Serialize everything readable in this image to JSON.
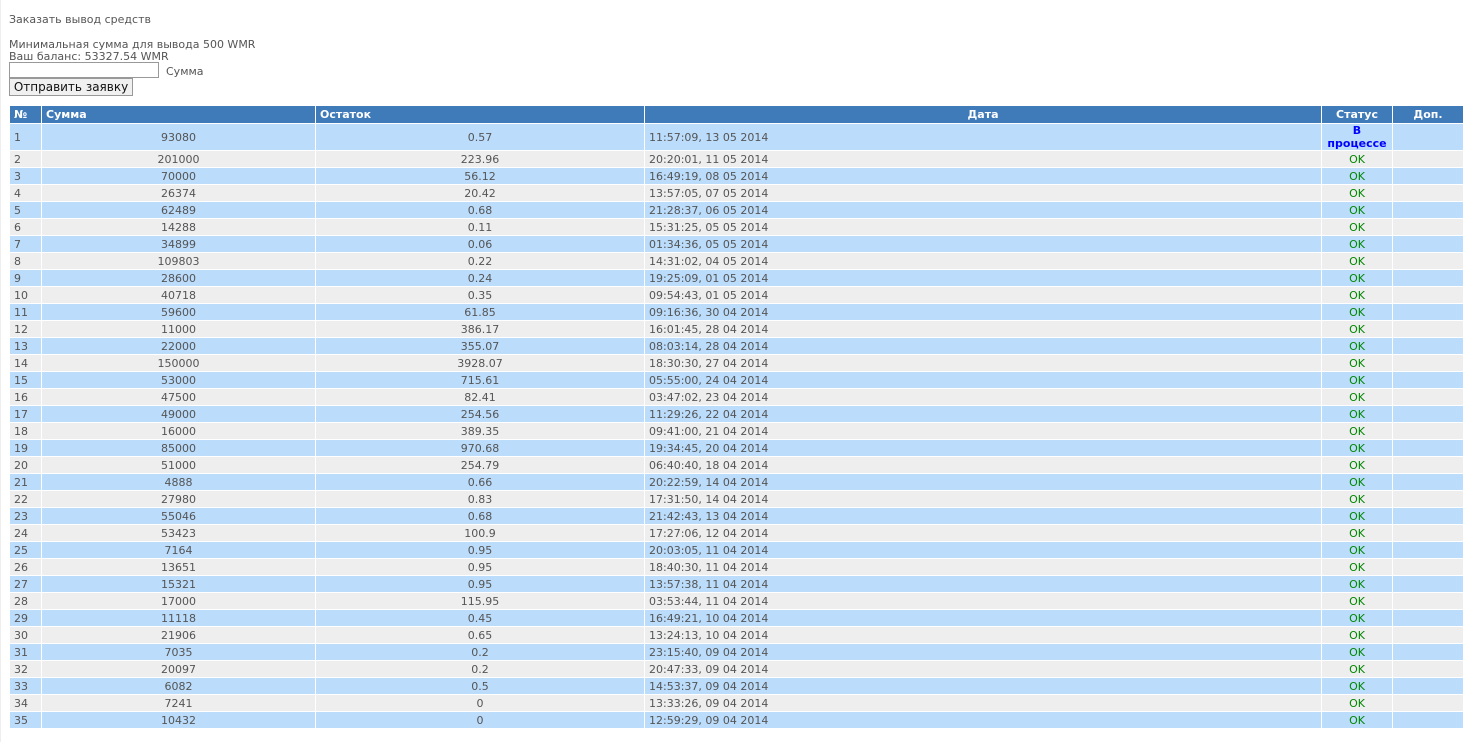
{
  "title": "Заказать вывод средств",
  "min_sum": "Минимальная сумма для вывода 500 WMR",
  "balance": "Ваш баланс: 53327.54 WMR",
  "amount_value": "",
  "amount_label": "Сумма",
  "submit_label": "Отправить заявку",
  "colors": {
    "header": "#3f7ab9",
    "row_odd": "#bbdcfb",
    "row_even": "#eeeeee",
    "ok": "#008800",
    "in_progress": "#0000ff"
  },
  "table": {
    "headers": [
      "№",
      "Сумма",
      "Остаток",
      "Дата",
      "Статус",
      "Доп."
    ],
    "rows": [
      [
        "1",
        "93080",
        "0.57",
        "11:57:09, 13 05 2014",
        "В процессе",
        ""
      ],
      [
        "2",
        "201000",
        "223.96",
        "20:20:01, 11 05 2014",
        "OK",
        ""
      ],
      [
        "3",
        "70000",
        "56.12",
        "16:49:19, 08 05 2014",
        "OK",
        ""
      ],
      [
        "4",
        "26374",
        "20.42",
        "13:57:05, 07 05 2014",
        "OK",
        ""
      ],
      [
        "5",
        "62489",
        "0.68",
        "21:28:37, 06 05 2014",
        "OK",
        ""
      ],
      [
        "6",
        "14288",
        "0.11",
        "15:31:25, 05 05 2014",
        "OK",
        ""
      ],
      [
        "7",
        "34899",
        "0.06",
        "01:34:36, 05 05 2014",
        "OK",
        ""
      ],
      [
        "8",
        "109803",
        "0.22",
        "14:31:02, 04 05 2014",
        "OK",
        ""
      ],
      [
        "9",
        "28600",
        "0.24",
        "19:25:09, 01 05 2014",
        "OK",
        ""
      ],
      [
        "10",
        "40718",
        "0.35",
        "09:54:43, 01 05 2014",
        "OK",
        ""
      ],
      [
        "11",
        "59600",
        "61.85",
        "09:16:36, 30 04 2014",
        "OK",
        ""
      ],
      [
        "12",
        "11000",
        "386.17",
        "16:01:45, 28 04 2014",
        "OK",
        ""
      ],
      [
        "13",
        "22000",
        "355.07",
        "08:03:14, 28 04 2014",
        "OK",
        ""
      ],
      [
        "14",
        "150000",
        "3928.07",
        "18:30:30, 27 04 2014",
        "OK",
        ""
      ],
      [
        "15",
        "53000",
        "715.61",
        "05:55:00, 24 04 2014",
        "OK",
        ""
      ],
      [
        "16",
        "47500",
        "82.41",
        "03:47:02, 23 04 2014",
        "OK",
        ""
      ],
      [
        "17",
        "49000",
        "254.56",
        "11:29:26, 22 04 2014",
        "OK",
        ""
      ],
      [
        "18",
        "16000",
        "389.35",
        "09:41:00, 21 04 2014",
        "OK",
        ""
      ],
      [
        "19",
        "85000",
        "970.68",
        "19:34:45, 20 04 2014",
        "OK",
        ""
      ],
      [
        "20",
        "51000",
        "254.79",
        "06:40:40, 18 04 2014",
        "OK",
        ""
      ],
      [
        "21",
        "4888",
        "0.66",
        "20:22:59, 14 04 2014",
        "OK",
        ""
      ],
      [
        "22",
        "27980",
        "0.83",
        "17:31:50, 14 04 2014",
        "OK",
        ""
      ],
      [
        "23",
        "55046",
        "0.68",
        "21:42:43, 13 04 2014",
        "OK",
        ""
      ],
      [
        "24",
        "53423",
        "100.9",
        "17:27:06, 12 04 2014",
        "OK",
        ""
      ],
      [
        "25",
        "7164",
        "0.95",
        "20:03:05, 11 04 2014",
        "OK",
        ""
      ],
      [
        "26",
        "13651",
        "0.95",
        "18:40:30, 11 04 2014",
        "OK",
        ""
      ],
      [
        "27",
        "15321",
        "0.95",
        "13:57:38, 11 04 2014",
        "OK",
        ""
      ],
      [
        "28",
        "17000",
        "115.95",
        "03:53:44, 11 04 2014",
        "OK",
        ""
      ],
      [
        "29",
        "11118",
        "0.45",
        "16:49:21, 10 04 2014",
        "OK",
        ""
      ],
      [
        "30",
        "21906",
        "0.65",
        "13:24:13, 10 04 2014",
        "OK",
        ""
      ],
      [
        "31",
        "7035",
        "0.2",
        "23:15:40, 09 04 2014",
        "OK",
        ""
      ],
      [
        "32",
        "20097",
        "0.2",
        "20:47:33, 09 04 2014",
        "OK",
        ""
      ],
      [
        "33",
        "6082",
        "0.5",
        "14:53:37, 09 04 2014",
        "OK",
        ""
      ],
      [
        "34",
        "7241",
        "0",
        "13:33:26, 09 04 2014",
        "OK",
        ""
      ],
      [
        "35",
        "10432",
        "0",
        "12:59:29, 09 04 2014",
        "OK",
        ""
      ]
    ]
  }
}
